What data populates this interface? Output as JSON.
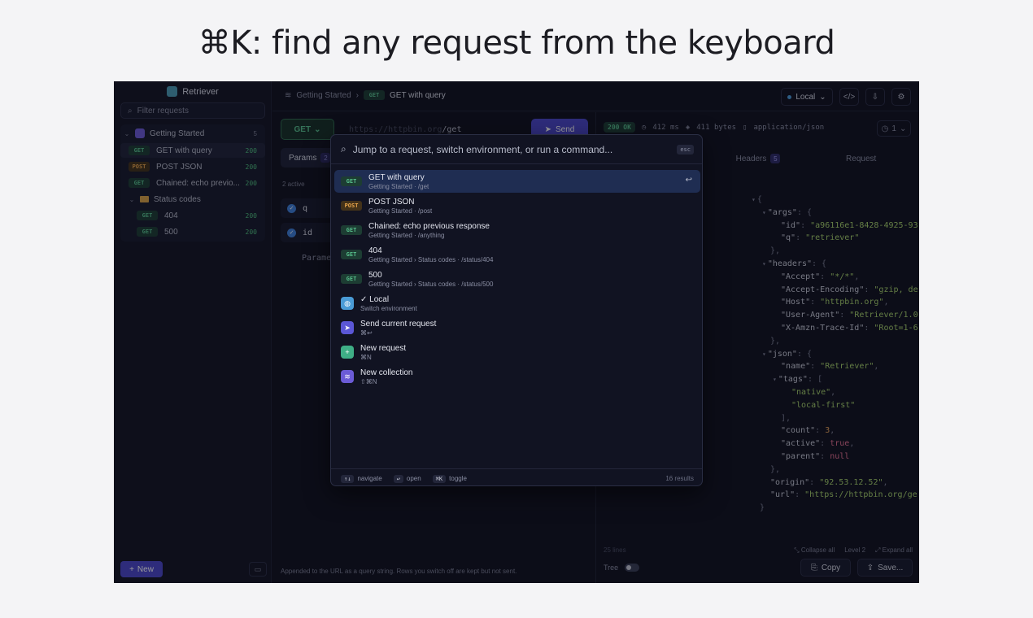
{
  "caption": "⌘K: find any request from the keyboard",
  "app": {
    "name": "Retriever",
    "filter_placeholder": "Filter requests",
    "collection": {
      "name": "Getting Started",
      "count": "5"
    },
    "requests": [
      {
        "method": "GET",
        "name": "GET with query",
        "status": "200"
      },
      {
        "method": "POST",
        "name": "POST JSON",
        "status": "200"
      },
      {
        "method": "GET",
        "name": "Chained: echo previo...",
        "status": "200"
      }
    ],
    "folder": {
      "name": "Status codes",
      "requests": [
        {
          "method": "GET",
          "name": "404",
          "status": "200"
        },
        {
          "method": "GET",
          "name": "500",
          "status": "200"
        }
      ]
    },
    "new_label": "New"
  },
  "topbar": {
    "crumb_collection": "Getting Started",
    "crumb_method": "GET",
    "crumb_request": "GET with query",
    "environment": "Local"
  },
  "request": {
    "method": "GET",
    "url_host": "https://httpbin.org",
    "url_path": "/get",
    "send_label": "Send",
    "tab_params": "Params",
    "params_count": "2",
    "active_label": "2 active",
    "params": [
      "q",
      "id"
    ],
    "param_hint": "Paramet",
    "footnote": "Appended to the URL as a query string. Rows you switch off are kept but not sent."
  },
  "response": {
    "status": "200 OK",
    "time": "412 ms",
    "size": "411 bytes",
    "content_type": "application/json",
    "history": "1",
    "tab_headers": "Headers",
    "headers_count": "5",
    "tab_request": "Request",
    "lines_label": "25 lines",
    "collapse_all": "Collapse all",
    "level": "Level 2",
    "expand_all": "Expand all",
    "tree_label": "Tree",
    "copy_label": "Copy",
    "save_label": "Save..."
  },
  "json_lines": [
    {
      "i": 0,
      "c": "▾",
      "t": [
        [
          "p",
          "{"
        ]
      ]
    },
    {
      "i": 1,
      "c": "▾",
      "t": [
        [
          "k",
          "\"args\""
        ],
        [
          "p",
          ": {"
        ]
      ]
    },
    {
      "i": 2,
      "c": "",
      "t": [
        [
          "k",
          "\"id\""
        ],
        [
          "p",
          ": "
        ],
        [
          "s",
          "\"a96116e1-8428-4925-93"
        ]
      ]
    },
    {
      "i": 2,
      "c": "",
      "t": [
        [
          "k",
          "\"q\""
        ],
        [
          "p",
          ": "
        ],
        [
          "s",
          "\"retriever\""
        ]
      ]
    },
    {
      "i": 1,
      "c": "",
      "t": [
        [
          "p",
          "},"
        ]
      ]
    },
    {
      "i": 1,
      "c": "▾",
      "t": [
        [
          "k",
          "\"headers\""
        ],
        [
          "p",
          ": {"
        ]
      ]
    },
    {
      "i": 2,
      "c": "",
      "t": [
        [
          "k",
          "\"Accept\""
        ],
        [
          "p",
          ": "
        ],
        [
          "s",
          "\"*/*\""
        ],
        [
          "p",
          ","
        ]
      ]
    },
    {
      "i": 2,
      "c": "",
      "t": [
        [
          "k",
          "\"Accept-Encoding\""
        ],
        [
          "p",
          ": "
        ],
        [
          "s",
          "\"gzip, de"
        ]
      ]
    },
    {
      "i": 2,
      "c": "",
      "t": [
        [
          "k",
          "\"Host\""
        ],
        [
          "p",
          ": "
        ],
        [
          "s",
          "\"httpbin.org\""
        ],
        [
          "p",
          ","
        ]
      ]
    },
    {
      "i": 2,
      "c": "",
      "t": [
        [
          "k",
          "\"User-Agent\""
        ],
        [
          "p",
          ": "
        ],
        [
          "s",
          "\"Retriever/1.0"
        ]
      ]
    },
    {
      "i": 2,
      "c": "",
      "t": [
        [
          "k",
          "\"X-Amzn-Trace-Id\""
        ],
        [
          "p",
          ": "
        ],
        [
          "s",
          "\"Root=1-6"
        ]
      ]
    },
    {
      "i": 1,
      "c": "",
      "t": [
        [
          "p",
          "},"
        ]
      ]
    },
    {
      "i": 1,
      "c": "▾",
      "t": [
        [
          "k",
          "\"json\""
        ],
        [
          "p",
          ": {"
        ]
      ]
    },
    {
      "i": 2,
      "c": "",
      "t": [
        [
          "k",
          "\"name\""
        ],
        [
          "p",
          ": "
        ],
        [
          "s",
          "\"Retriever\""
        ],
        [
          "p",
          ","
        ]
      ]
    },
    {
      "i": 2,
      "c": "▾",
      "t": [
        [
          "k",
          "\"tags\""
        ],
        [
          "p",
          ": ["
        ]
      ]
    },
    {
      "i": 3,
      "c": "",
      "t": [
        [
          "s",
          "\"native\""
        ],
        [
          "p",
          ","
        ]
      ]
    },
    {
      "i": 3,
      "c": "",
      "t": [
        [
          "s",
          "\"local-first\""
        ]
      ]
    },
    {
      "i": 2,
      "c": "",
      "t": [
        [
          "p",
          "],"
        ]
      ]
    },
    {
      "i": 2,
      "c": "",
      "t": [
        [
          "k",
          "\"count\""
        ],
        [
          "p",
          ": "
        ],
        [
          "n",
          "3"
        ],
        [
          "p",
          ","
        ]
      ]
    },
    {
      "i": 2,
      "c": "",
      "t": [
        [
          "k",
          "\"active\""
        ],
        [
          "p",
          ": "
        ],
        [
          "b",
          "true"
        ],
        [
          "p",
          ","
        ]
      ]
    },
    {
      "i": 2,
      "c": "",
      "t": [
        [
          "k",
          "\"parent\""
        ],
        [
          "p",
          ": "
        ],
        [
          "b",
          "null"
        ]
      ]
    },
    {
      "i": 1,
      "c": "",
      "t": [
        [
          "p",
          "},"
        ]
      ]
    },
    {
      "i": 1,
      "c": "",
      "t": [
        [
          "k",
          "\"origin\""
        ],
        [
          "p",
          ": "
        ],
        [
          "s",
          "\"92.53.12.52\""
        ],
        [
          "p",
          ","
        ]
      ]
    },
    {
      "i": 1,
      "c": "",
      "t": [
        [
          "k",
          "\"url\""
        ],
        [
          "p",
          ": "
        ],
        [
          "s",
          "\"https://httpbin.org/ge"
        ]
      ]
    },
    {
      "i": 0,
      "c": "",
      "t": [
        [
          "p",
          "}"
        ]
      ]
    }
  ],
  "palette": {
    "placeholder": "Jump to a request, switch environment, or run a command...",
    "esc": "esc",
    "items": [
      {
        "kind": "request",
        "method": "GET",
        "title": "GET with query",
        "sub": "Getting Started  ·  /get",
        "selected": true
      },
      {
        "kind": "request",
        "method": "POST",
        "title": "POST JSON",
        "sub": "Getting Started  ·  /post"
      },
      {
        "kind": "request",
        "method": "GET",
        "title": "Chained: echo previous response",
        "sub": "Getting Started  ·  /anything"
      },
      {
        "kind": "request",
        "method": "GET",
        "title": "404",
        "sub": "Getting Started › Status codes  ·  /status/404"
      },
      {
        "kind": "request",
        "method": "GET",
        "title": "500",
        "sub": "Getting Started › Status codes  ·  /status/500"
      },
      {
        "kind": "env",
        "icon": "globe-icon",
        "color": "#4a9bd6",
        "title": "✓ Local",
        "sub": "Switch environment"
      },
      {
        "kind": "command",
        "icon": "send-icon",
        "color": "#5b57d6",
        "title": "Send current request",
        "sub": "⌘↩"
      },
      {
        "kind": "command",
        "icon": "plus-icon",
        "color": "#3fae86",
        "title": "New request",
        "sub": "⌘N"
      },
      {
        "kind": "command",
        "icon": "stack-icon",
        "color": "#6b5bd6",
        "title": "New collection",
        "sub": "⇧⌘N"
      }
    ],
    "footer": {
      "nav_key": "↑↓",
      "nav_label": "navigate",
      "open_key": "↩",
      "open_label": "open",
      "toggle_key": "⌘K",
      "toggle_label": "toggle",
      "results": "16 results"
    }
  },
  "colors": {
    "accent": "#4a47c9",
    "get": "#57c08c",
    "post": "#e7a44b"
  }
}
